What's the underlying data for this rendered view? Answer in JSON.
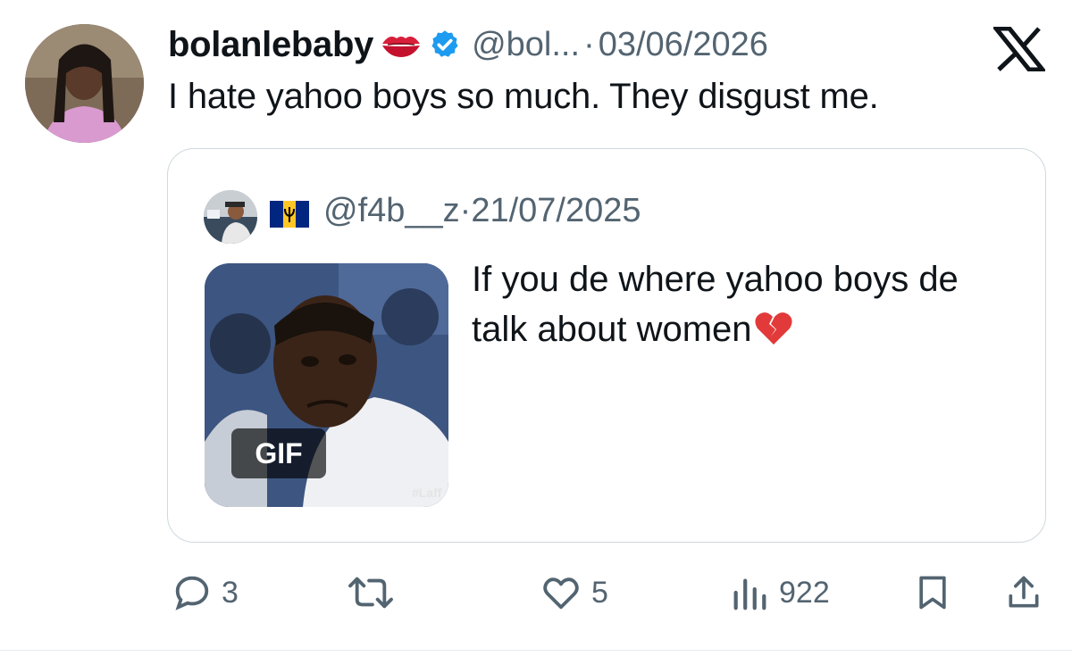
{
  "tweet": {
    "display_name": "bolanlebaby",
    "handle": "@bol...",
    "separator": "·",
    "date": "03/06/2026",
    "text": "I hate yahoo boys so much. They disgust me.",
    "name_emoji": "kiss-mark-icon",
    "verified_icon": "verified-badge-icon",
    "brand_icon": "x-logo-icon"
  },
  "quote": {
    "handle": "@f4b__z",
    "separator": "·",
    "date": "21/07/2025",
    "flag": "barbados-flag-icon",
    "text": "If you de where yahoo boys de talk about women",
    "text_emoji": "broken-heart-icon",
    "media_badge": "GIF",
    "media_watermark": "#Laff"
  },
  "actions": {
    "reply_count": "3",
    "retweet_count": "",
    "like_count": "5",
    "views_count": "922"
  },
  "colors": {
    "text": "#0f1419",
    "secondary": "#536471",
    "verified": "#1d9bf0",
    "border": "#cfd9de"
  }
}
